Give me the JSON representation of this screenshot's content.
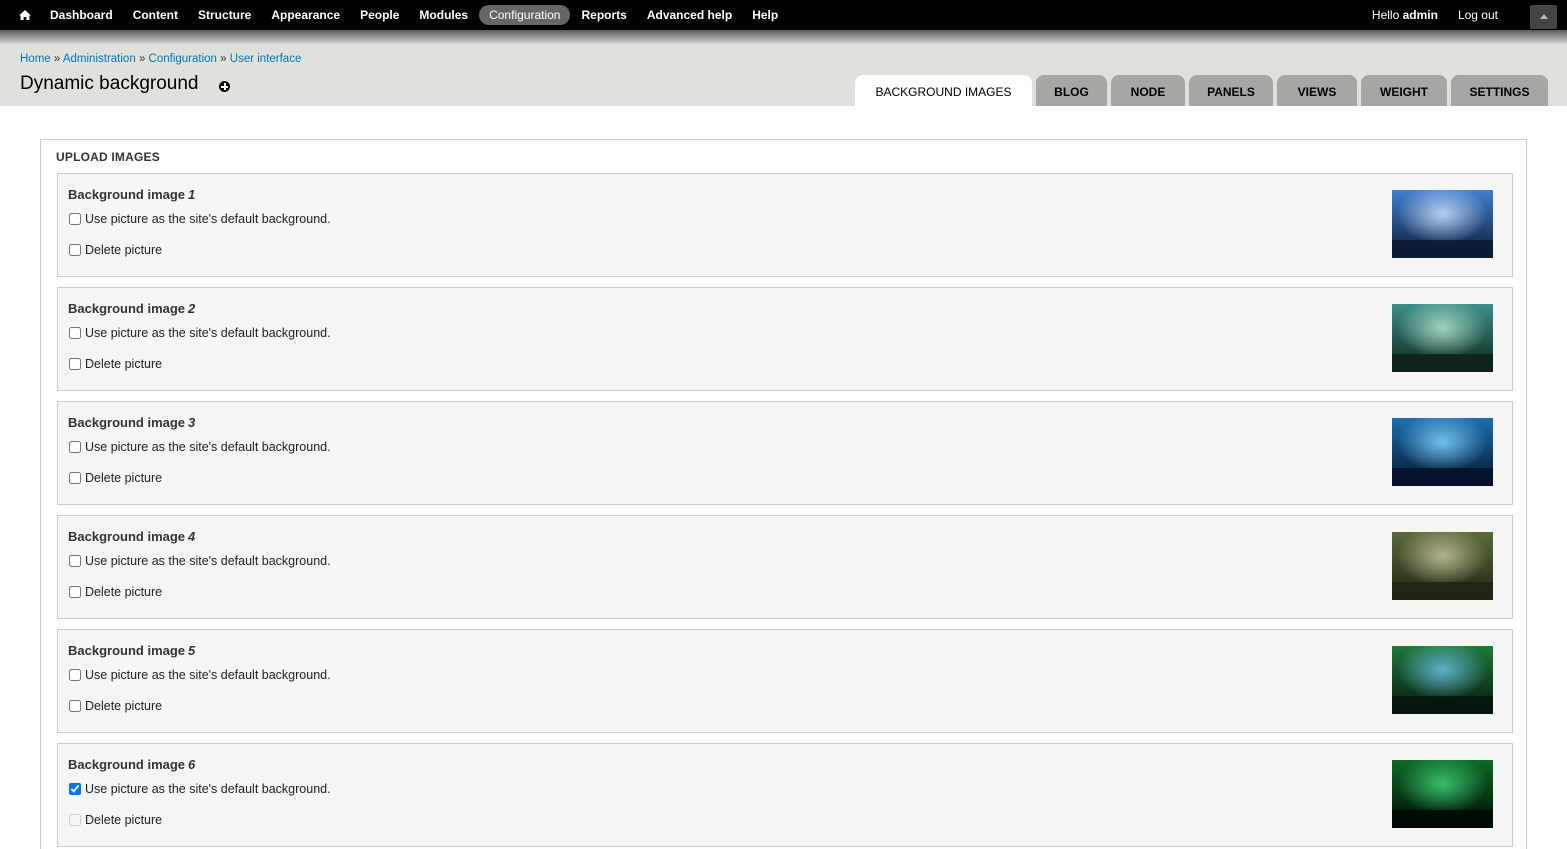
{
  "toolbar": {
    "menu": [
      "Dashboard",
      "Content",
      "Structure",
      "Appearance",
      "People",
      "Modules",
      "Configuration",
      "Reports",
      "Advanced help",
      "Help"
    ],
    "active": "Configuration",
    "hello_prefix": "Hello ",
    "username": "admin",
    "logout": "Log out",
    "home_icon": "home-icon",
    "drawer_icon": "caret-up-icon"
  },
  "breadcrumb": {
    "items": [
      "Home",
      "Administration",
      "Configuration",
      "User interface"
    ],
    "separator": "»"
  },
  "page_title": "Dynamic background",
  "tabs": [
    "BACKGROUND IMAGES",
    "BLOG",
    "NODE",
    "PANELS",
    "VIEWS",
    "WEIGHT",
    "SETTINGS"
  ],
  "active_tab": "BACKGROUND IMAGES",
  "fieldset": {
    "legend": "UPLOAD IMAGES",
    "items": [
      {
        "label": "Background image",
        "number": "1",
        "default_label": "Use picture as the site's default background.",
        "default_checked": false,
        "delete_label": "Delete picture",
        "delete_disabled": false
      },
      {
        "label": "Background image",
        "number": "2",
        "default_label": "Use picture as the site's default background.",
        "default_checked": false,
        "delete_label": "Delete picture",
        "delete_disabled": false
      },
      {
        "label": "Background image",
        "number": "3",
        "default_label": "Use picture as the site's default background.",
        "default_checked": false,
        "delete_label": "Delete picture",
        "delete_disabled": false
      },
      {
        "label": "Background image",
        "number": "4",
        "default_label": "Use picture as the site's default background.",
        "default_checked": false,
        "delete_label": "Delete picture",
        "delete_disabled": false
      },
      {
        "label": "Background image",
        "number": "5",
        "default_label": "Use picture as the site's default background.",
        "default_checked": false,
        "delete_label": "Delete picture",
        "delete_disabled": false
      },
      {
        "label": "Background image",
        "number": "6",
        "default_label": "Use picture as the site's default background.",
        "default_checked": true,
        "delete_label": "Delete picture",
        "delete_disabled": true
      }
    ]
  },
  "thumb_colors": [
    [
      "#0a1a33",
      "#3f7fd0",
      "#cfe4ff"
    ],
    [
      "#0d2218",
      "#3c8f8a",
      "#b5e6d0"
    ],
    [
      "#04122a",
      "#1d6fb0",
      "#7fd4ff"
    ],
    [
      "#1c2414",
      "#5b6b3a",
      "#c9c4a0"
    ],
    [
      "#07140c",
      "#1e7a3a",
      "#6ac0e8"
    ],
    [
      "#000805",
      "#0e6b25",
      "#3fd37a"
    ]
  ]
}
